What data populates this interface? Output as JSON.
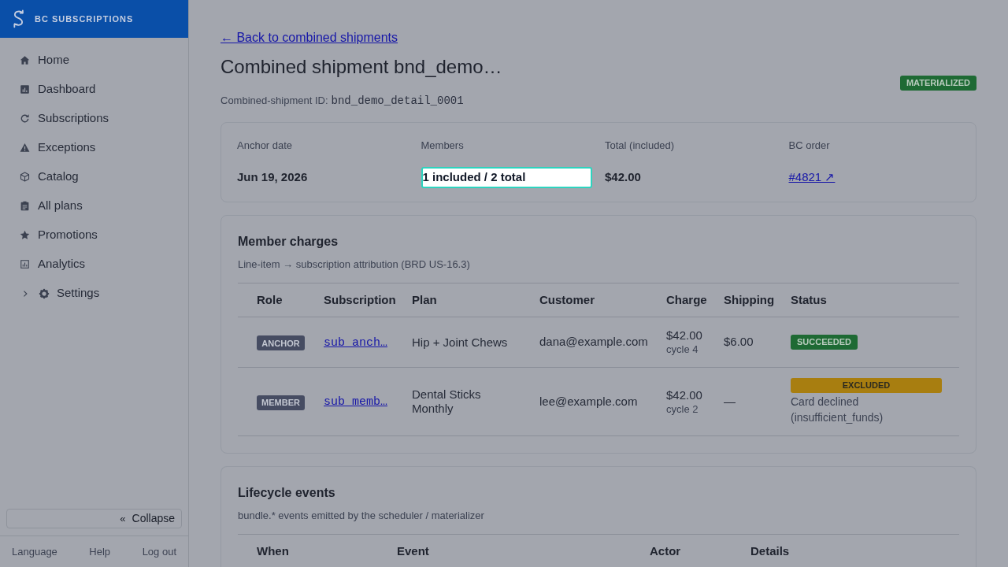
{
  "sidebar": {
    "brand": "BC SUBSCRIPTIONS",
    "items": [
      {
        "label": "Home",
        "kind": "link"
      },
      {
        "label": "Dashboard",
        "kind": "link"
      },
      {
        "label": "Subscriptions",
        "kind": "link"
      },
      {
        "label": "Exceptions",
        "kind": "link"
      },
      {
        "label": "Catalog",
        "kind": "link"
      },
      {
        "label": "All plans",
        "kind": "link"
      },
      {
        "label": "Promotions",
        "kind": "link"
      },
      {
        "label": "Analytics",
        "kind": "link"
      },
      {
        "label": "Settings",
        "kind": "group",
        "expanded": false
      }
    ],
    "collapse": {
      "glyph": "«",
      "label": "Collapse"
    },
    "footer_links": [
      "Language",
      "Help",
      "Log out"
    ]
  },
  "page": {
    "back_link": "← Back to combined shipments",
    "title": "Combined shipment bnd_demo…",
    "status_badge": "MATERIALIZED",
    "id_label": "Combined-shipment ID:",
    "id_value": "bnd_demo_detail_0001",
    "summary": [
      {
        "label": "Anchor date",
        "value": "Jun 19, 2026",
        "kind": "text",
        "highlighted": false
      },
      {
        "label": "Members",
        "value": "1 included / 2 total",
        "kind": "text",
        "highlighted": true
      },
      {
        "label": "Total (included)",
        "value": "$42.00",
        "kind": "text",
        "highlighted": false
      },
      {
        "label": "BC order",
        "value": "#4821 ↗",
        "kind": "link",
        "highlighted": false
      }
    ],
    "member_charges": {
      "title": "Member charges",
      "subtitle": "Line-item → subscription attribution (BRD US-16.3)",
      "columns": [
        "Role",
        "Subscription",
        "Plan",
        "Customer",
        "Charge",
        "Shipping",
        "Status"
      ],
      "rows": [
        {
          "role": "ANCHOR",
          "subscription": "sub_anch…",
          "plan": "Hip + Joint Chews",
          "customer": "dana@example.com",
          "charge": "$42.00",
          "cycle": "cycle 4",
          "shipping": "$6.00",
          "status": {
            "label": "SUCCEEDED",
            "color": "#1e6a34"
          }
        },
        {
          "role": "MEMBER",
          "subscription": "sub_memb…",
          "plan": "Dental Sticks Monthly",
          "customer": "lee@example.com",
          "charge": "$42.00",
          "cycle": "cycle 2",
          "shipping": "—",
          "status": {
            "label": "EXCLUDED",
            "color": "#a87e10",
            "note": "Card declined (insufficient_funds)"
          }
        }
      ]
    },
    "lifecycle_events": {
      "title": "Lifecycle events",
      "subtitle": "bundle.* events emitted by the scheduler / materializer",
      "columns": [
        "When",
        "Event",
        "Actor",
        "Details"
      ]
    }
  }
}
